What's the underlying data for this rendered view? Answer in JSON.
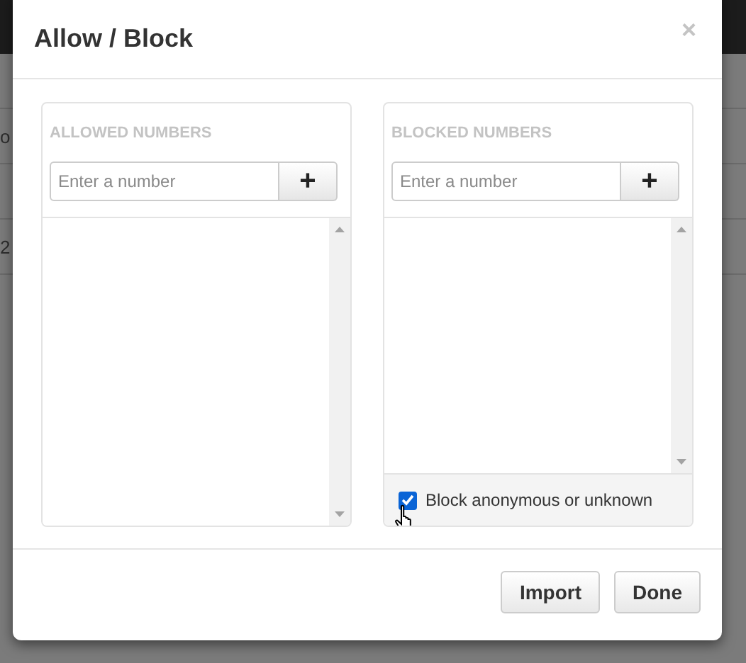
{
  "background": {
    "texts": [
      "o",
      "2"
    ]
  },
  "dialog": {
    "title": "Allow / Block",
    "close": "×",
    "panels": [
      {
        "kind": "list",
        "heading": "ALLOWED NUMBERS",
        "placeholder": "Enter a number",
        "add": "+"
      },
      {
        "kind": "list_with_option",
        "heading": "BLOCKED NUMBERS",
        "placeholder": "Enter a number",
        "add": "+",
        "option": {
          "label": "Block anonymous or unknown",
          "checked": true
        }
      }
    ],
    "buttons": [
      "Import",
      "Done"
    ]
  }
}
